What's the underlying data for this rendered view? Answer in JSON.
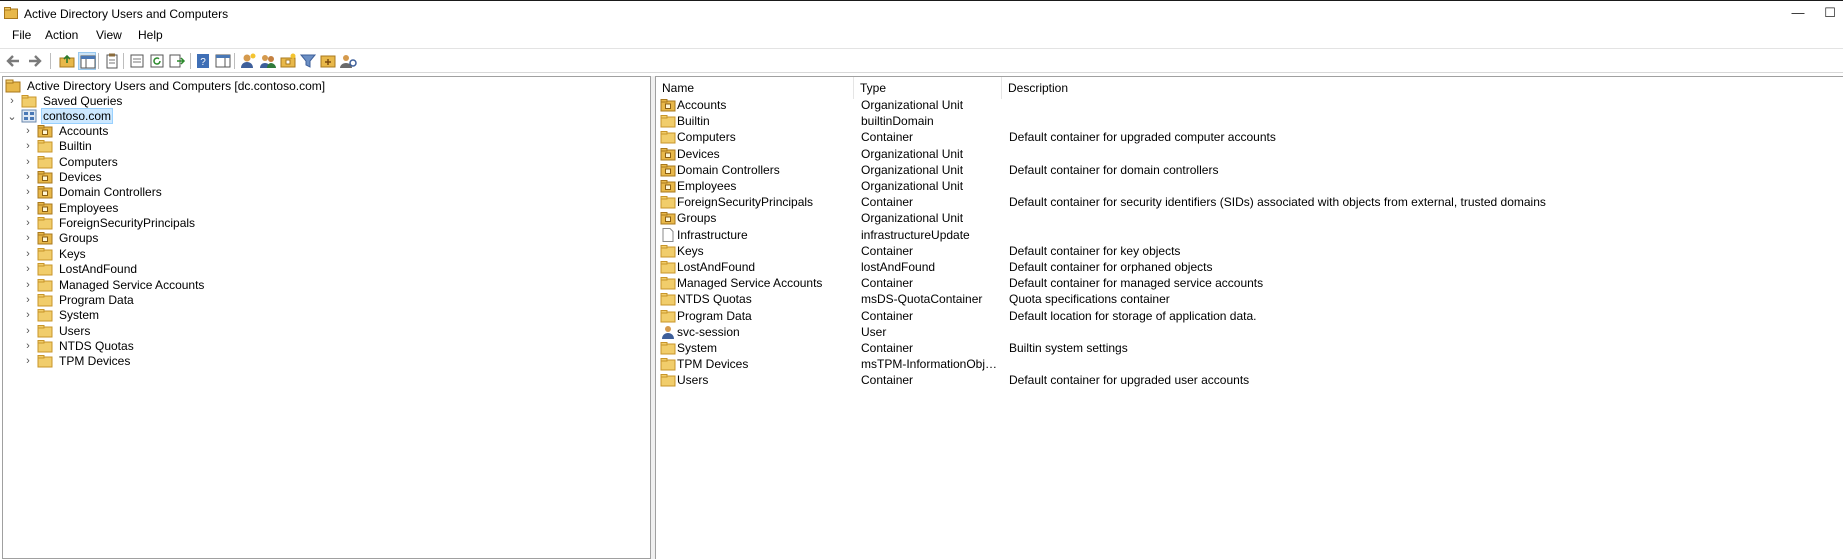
{
  "window": {
    "title": "Active Directory Users and Computers",
    "minimize_glyph": "—",
    "maximize_glyph": "☐"
  },
  "menu": [
    "File",
    "Action",
    "View",
    "Help"
  ],
  "toolbar": {
    "icons": [
      "back-arrow-icon",
      "forward-arrow-icon",
      "up-folder-icon",
      "show-console-tree-icon",
      "properties-icon",
      "export-list-icon",
      "refresh-icon",
      "export-icon",
      "help-icon",
      "show-action-pane-icon",
      "create-user-icon",
      "create-group-icon",
      "create-ou-icon",
      "filter-icon",
      "add-to-group-icon",
      "delegate-control-icon"
    ]
  },
  "tree": {
    "root": "Active Directory Users and Computers [dc.contoso.com]",
    "saved_queries": "Saved Queries",
    "domain": "contoso.com",
    "children": [
      {
        "label": "Accounts",
        "icon": "ou"
      },
      {
        "label": "Builtin",
        "icon": "folder"
      },
      {
        "label": "Computers",
        "icon": "folder"
      },
      {
        "label": "Devices",
        "icon": "ou"
      },
      {
        "label": "Domain Controllers",
        "icon": "ou"
      },
      {
        "label": "Employees",
        "icon": "ou"
      },
      {
        "label": "ForeignSecurityPrincipals",
        "icon": "folder"
      },
      {
        "label": "Groups",
        "icon": "ou"
      },
      {
        "label": "Keys",
        "icon": "folder"
      },
      {
        "label": "LostAndFound",
        "icon": "folder"
      },
      {
        "label": "Managed Service Accounts",
        "icon": "folder"
      },
      {
        "label": "Program Data",
        "icon": "folder"
      },
      {
        "label": "System",
        "icon": "folder"
      },
      {
        "label": "Users",
        "icon": "folder"
      },
      {
        "label": "NTDS Quotas",
        "icon": "folder"
      },
      {
        "label": "TPM Devices",
        "icon": "folder"
      }
    ]
  },
  "list": {
    "columns": [
      "Name",
      "Type",
      "Description"
    ],
    "rows": [
      {
        "name": "Accounts",
        "type": "Organizational Unit",
        "description": "",
        "icon": "ou"
      },
      {
        "name": "Builtin",
        "type": "builtinDomain",
        "description": "",
        "icon": "builtin"
      },
      {
        "name": "Computers",
        "type": "Container",
        "description": "Default container for upgraded computer accounts",
        "icon": "folder"
      },
      {
        "name": "Devices",
        "type": "Organizational Unit",
        "description": "",
        "icon": "ou"
      },
      {
        "name": "Domain Controllers",
        "type": "Organizational Unit",
        "description": "Default container for domain controllers",
        "icon": "ou"
      },
      {
        "name": "Employees",
        "type": "Organizational Unit",
        "description": "",
        "icon": "ou"
      },
      {
        "name": "ForeignSecurityPrincipals",
        "type": "Container",
        "description": "Default container for security identifiers (SIDs) associated with objects from external, trusted domains",
        "icon": "folder"
      },
      {
        "name": "Groups",
        "type": "Organizational Unit",
        "description": "",
        "icon": "ou"
      },
      {
        "name": "Infrastructure",
        "type": "infrastructureUpdate",
        "description": "",
        "icon": "doc"
      },
      {
        "name": "Keys",
        "type": "Container",
        "description": "Default container for key objects",
        "icon": "folder"
      },
      {
        "name": "LostAndFound",
        "type": "lostAndFound",
        "description": "Default container for orphaned objects",
        "icon": "folder"
      },
      {
        "name": "Managed Service Accounts",
        "type": "Container",
        "description": "Default container for managed service accounts",
        "icon": "folder"
      },
      {
        "name": "NTDS Quotas",
        "type": "msDS-QuotaContainer",
        "description": "Quota specifications container",
        "icon": "folder"
      },
      {
        "name": "Program Data",
        "type": "Container",
        "description": "Default location for storage of application data.",
        "icon": "folder"
      },
      {
        "name": "svc-session",
        "type": "User",
        "description": "",
        "icon": "user"
      },
      {
        "name": "System",
        "type": "Container",
        "description": "Builtin system settings",
        "icon": "folder"
      },
      {
        "name": "TPM Devices",
        "type": "msTPM-InformationObjects...",
        "description": "",
        "icon": "folder"
      },
      {
        "name": "Users",
        "type": "Container",
        "description": "Default container for upgraded user accounts",
        "icon": "folder"
      }
    ]
  },
  "colors": {
    "folder": "#e8b84a",
    "folder_dark": "#c8952a",
    "selection": "#cce8ff",
    "selection_border": "#99d1ff"
  }
}
